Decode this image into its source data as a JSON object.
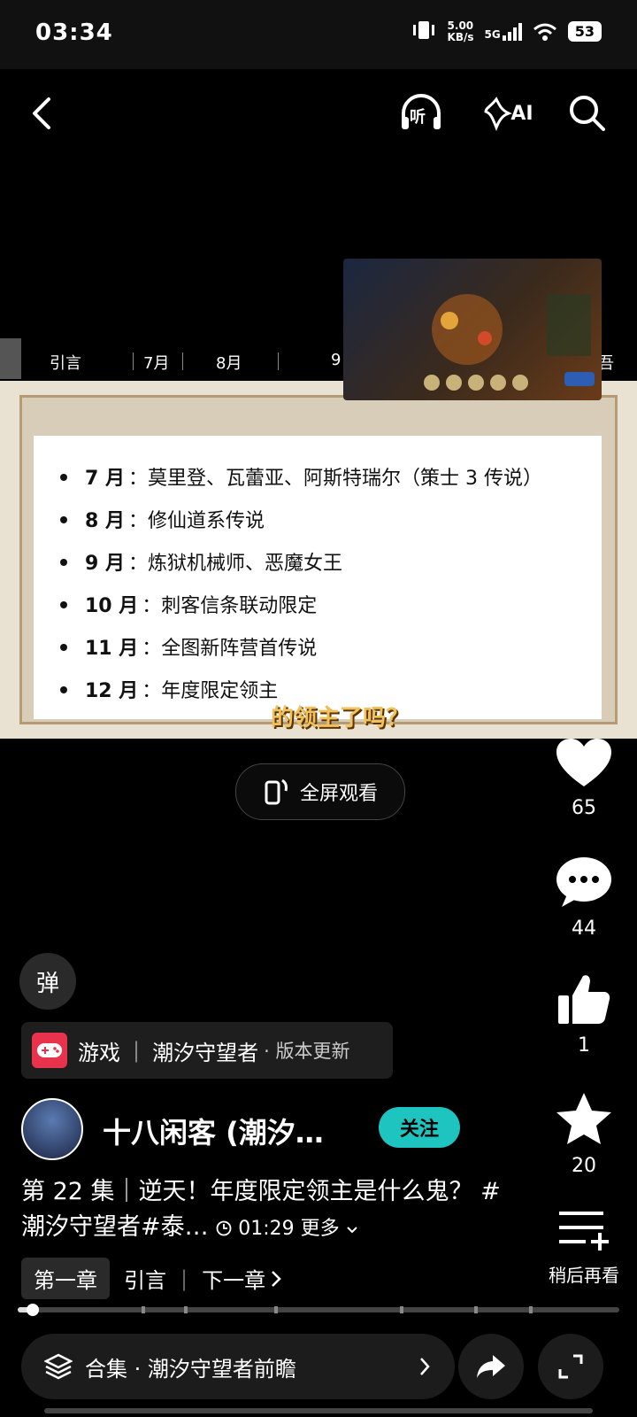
{
  "status_bar": {
    "time": "03:34",
    "speed_value": "5.00",
    "speed_unit": "KB/s",
    "network": "5G",
    "battery": "53"
  },
  "nav": {
    "listen_label": "听",
    "ai_label": "AI"
  },
  "chapters": {
    "items": [
      "引言",
      "7月",
      "8月",
      "9",
      "吾"
    ]
  },
  "slide": {
    "items": [
      {
        "month": "7 月",
        "text": "：莫里登、瓦蕾亚、阿斯特瑞尔（策士 3 传说）"
      },
      {
        "month": "8 月",
        "text": "：修仙道系传说"
      },
      {
        "month": "9 月",
        "text": "：炼狱机械师、恶魔女王"
      },
      {
        "month": "10 月",
        "text": "：刺客信条联动限定"
      },
      {
        "month": "11 月",
        "text": "：全图新阵营首传说"
      },
      {
        "month": "12 月",
        "text": "：年度限定领主"
      }
    ],
    "subtitle": "的领主了吗？"
  },
  "fullscreen_label": "全屏观看",
  "actions": {
    "like_count": "65",
    "comment_count": "44",
    "thumb_count": "1",
    "fav_count": "20",
    "later_label": "稍后再看"
  },
  "danmu_label": "弹",
  "tag": {
    "category": "游戏",
    "game": "潮汐守望者",
    "sub": "· 版本更新"
  },
  "author": {
    "name": "十八闲客 (潮汐…",
    "follow_label": "关注"
  },
  "description": {
    "text": "第 22 集｜逆天！年度限定领主是什么鬼？ #潮汐守望者#泰…",
    "duration": "01:29",
    "more_label": "更多"
  },
  "chapter_row": {
    "tag": "第一章",
    "current": "引言",
    "next": "下一章"
  },
  "progress": {
    "value": 0.02
  },
  "collection": {
    "label": "合集 · 潮汐守望者前瞻"
  }
}
